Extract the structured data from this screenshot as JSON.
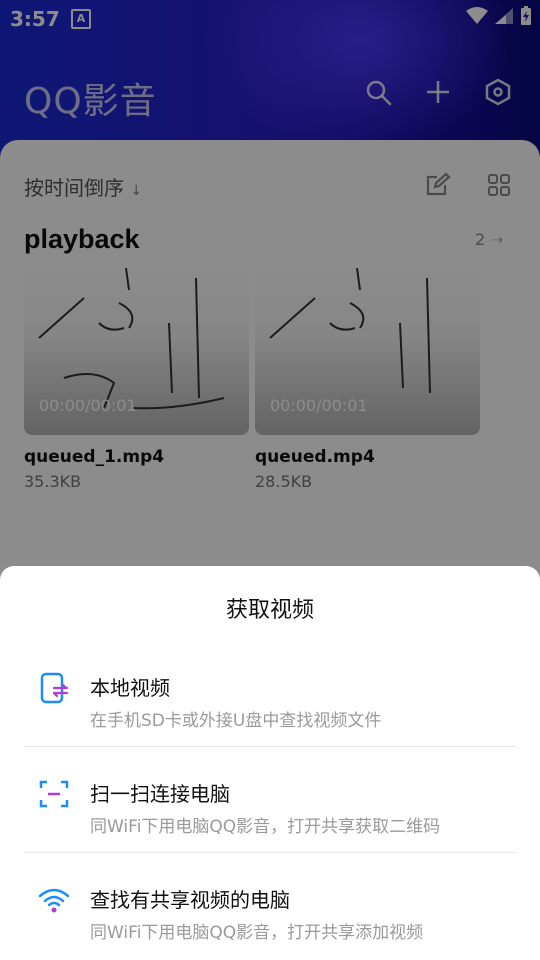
{
  "status_bar": {
    "time": "3:57",
    "notif_letter": "A"
  },
  "header": {
    "app_title": "QQ影音",
    "icons": [
      "search-icon",
      "plus-icon",
      "settings-hex-icon"
    ]
  },
  "library": {
    "sort_label": "按时间倒序",
    "folder": {
      "name": "playback",
      "count": "2"
    },
    "videos": [
      {
        "name": "queued_1.mp4",
        "size": "35.3KB",
        "time": "00:00/00:01"
      },
      {
        "name": "queued.mp4",
        "size": "28.5KB",
        "time": "00:00/00:01"
      }
    ]
  },
  "sheet": {
    "title": "获取视频",
    "options": [
      {
        "title": "本地视频",
        "subtitle": "在手机SD卡或外接U盘中查找视频文件",
        "icon": "local-video-icon"
      },
      {
        "title": "扫一扫连接电脑",
        "subtitle": "同WiFi下用电脑QQ影音，打开共享获取二维码",
        "icon": "scan-icon"
      },
      {
        "title": "查找有共享视频的电脑",
        "subtitle": "同WiFi下用电脑QQ影音，打开共享添加视频",
        "icon": "wifi-icon"
      }
    ]
  },
  "colors": {
    "accent": "#1a8cff",
    "header_start": "#1b2bd6",
    "header_end": "#0a0a7a"
  }
}
